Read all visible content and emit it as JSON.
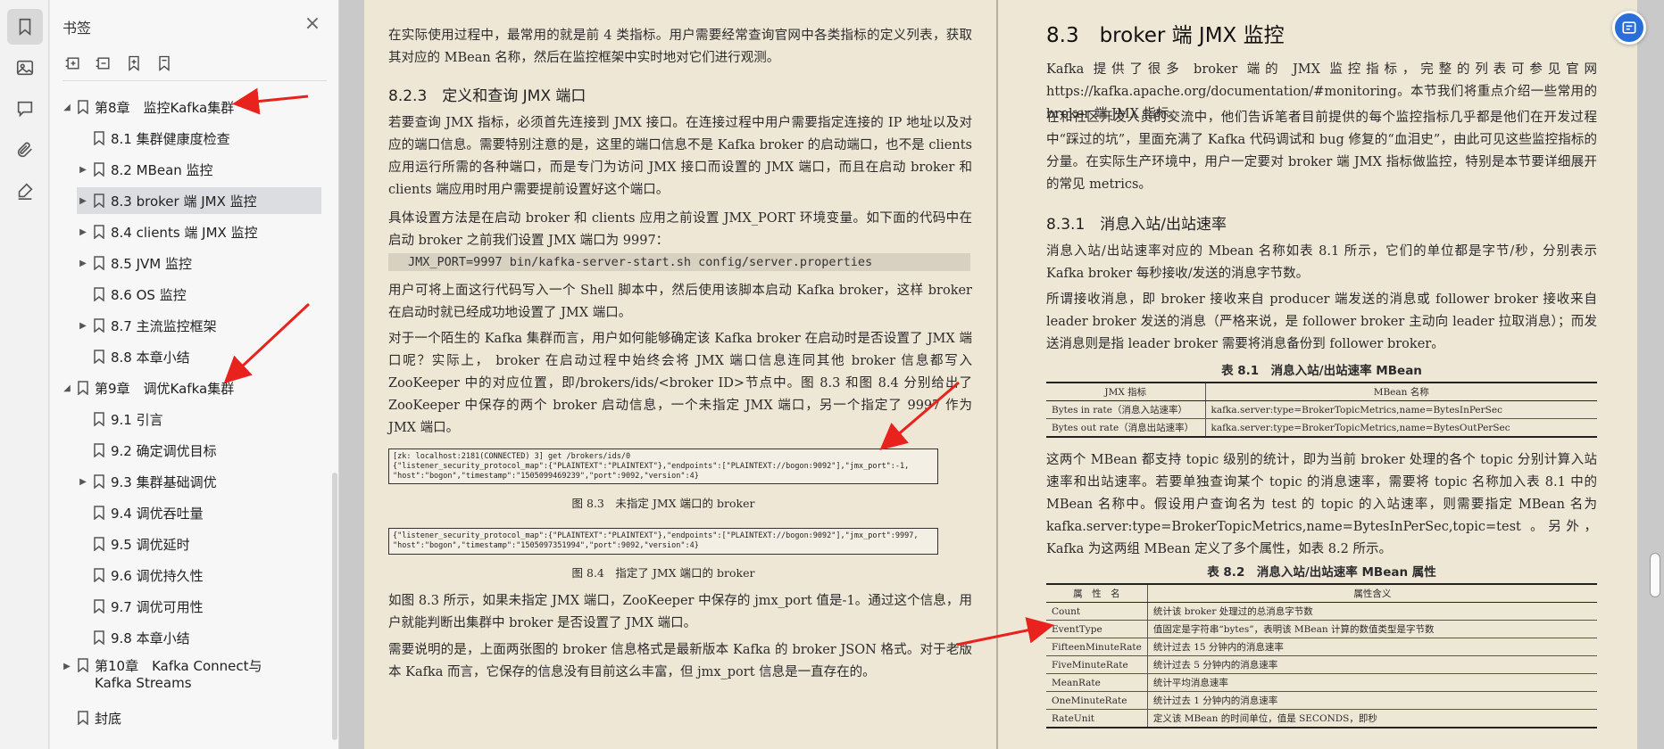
{
  "sidebar_panel": {
    "title": "书签",
    "items": [
      {
        "label": "第8章　监控Kafka集群",
        "level": 0,
        "expanded": true
      },
      {
        "label": "8.1 集群健康度检查",
        "level": 1
      },
      {
        "label": "8.2 MBean 监控",
        "level": 1,
        "collapsed": true
      },
      {
        "label": "8.3 broker 端 JMX 监控",
        "level": 1,
        "collapsed": true,
        "selected": true
      },
      {
        "label": "8.4 clients 端 JMX 监控",
        "level": 1,
        "collapsed": true
      },
      {
        "label": "8.5 JVM 监控",
        "level": 1,
        "collapsed": true
      },
      {
        "label": "8.6 OS 监控",
        "level": 1
      },
      {
        "label": "8.7 主流监控框架",
        "level": 1,
        "collapsed": true
      },
      {
        "label": "8.8 本章小结",
        "level": 1
      },
      {
        "label": "第9章　调优Kafka集群",
        "level": 0,
        "expanded": true
      },
      {
        "label": "9.1 引言",
        "level": 1
      },
      {
        "label": "9.2 确定调优目标",
        "level": 1
      },
      {
        "label": "9.3 集群基础调优",
        "level": 1,
        "collapsed": true
      },
      {
        "label": "9.4 调优吞吐量",
        "level": 1
      },
      {
        "label": "9.5 调优延时",
        "level": 1
      },
      {
        "label": "9.6 调优持久性",
        "level": 1
      },
      {
        "label": "9.7 调优可用性",
        "level": 1
      },
      {
        "label": "9.8 本章小结",
        "level": 1
      },
      {
        "label": "第10章　Kafka Connect与Kafka Streams",
        "level": 0,
        "collapsed": true
      },
      {
        "label": "封底",
        "level": 0
      }
    ]
  },
  "left_page": {
    "p1": "在实际使用过程中，最常用的就是前 4 类指标。用户需要经常查询官网中各类指标的定义列表，获取其对应的 MBean 名称，然后在监控框架中实时地对它们进行观测。",
    "h_823": "8.2.3　定义和查询 JMX 端口",
    "p2": "若要查询 JMX 指标，必须首先连接到 JMX 接口。在连接过程中用户需要指定连接的 IP 地址以及对应的端口信息。需要特别注意的是，这里的端口信息不是 Kafka broker 的启动端口，也不是 clients 应用运行所需的各种端口，而是专门为访问 JMX 接口而设置的 JMX 端口，而且在启动 broker 和 clients 端应用时用户需要提前设置好这个端口。",
    "p3": "具体设置方法是在启动 broker 和 clients 应用之前设置 JMX_PORT 环境变量。如下面的代码中在启动 broker 之前我们设置 JMX 端口为 9997：",
    "code1": "JMX_PORT=9997 bin/kafka-server-start.sh config/server.properties",
    "p4": "用户可将上面这行代码写入一个 Shell 脚本中，然后使用该脚本启动 Kafka broker，这样 broker 在启动时就已经成功地设置了 JMX 端口。",
    "p5": "对于一个陌生的 Kafka 集群而言，用户如何能够确定该 Kafka broker 在启动时是否设置了 JMX 端口呢？实际上， broker 在启动过程中始终会将 JMX 端口信息连同其他 broker 信息都写入 ZooKeeper 中的对应位置，即/brokers/ids/<broker ID>节点中。图 8.3 和图 8.4 分别给出了 ZooKeeper 中保存的两个 broker 启动信息，一个未指定 JMX 端口，另一个指定了 9997 作为 JMX 端口。",
    "fig3_code": "[zk: localhost:2181(CONNECTED) 3] get /brokers/ids/0\n{\"listener_security_protocol_map\":{\"PLAINTEXT\":\"PLAINTEXT\"},\"endpoints\":[\"PLAINTEXT://bogon:9092\"],\"jmx_port\":-1,\n\"host\":\"bogon\",\"timestamp\":\"1505099469239\",\"port\":9092,\"version\":4}",
    "fig3_cap": "图 8.3　未指定 JMX 端口的 broker",
    "fig4_code": "{\"listener_security_protocol_map\":{\"PLAINTEXT\":\"PLAINTEXT\"},\"endpoints\":[\"PLAINTEXT://bogon:9092\"],\"jmx_port\":9997,\n\"host\":\"bogon\",\"timestamp\":\"1505097351994\",\"port\":9092,\"version\":4}",
    "fig4_cap": "图 8.4　指定了 JMX 端口的 broker",
    "p6": "如图 8.3 所示，如果未指定 JMX 端口，ZooKeeper 中保存的 jmx_port 值是-1。通过这个信息，用户就能判断出集群中 broker 是否设置了 JMX 端口。",
    "p7": "需要说明的是，上面两张图的 broker 信息格式是最新版本 Kafka 的 broker JSON 格式。对于老版本 Kafka 而言，它保存的信息没有目前这么丰富，但 jmx_port 信息是一直存在的。"
  },
  "right_page": {
    "h_83": "8.3　broker 端 JMX 监控",
    "p1": "Kafka 提供了很多 broker 端的 JMX 监控指标，完整的列表可参见官网 https://kafka.apache.org/documentation/#monitoring。本节我们将重点介绍一些常用的 broker 端 JMX 指标。",
    "p2": "在和社区开发人员的交流中，他们告诉笔者目前提供的每个监控指标几乎都是他们在开发过程中“踩过的坑”，里面充满了 Kafka 代码调试和 bug 修复的“血泪史”，由此可见这些监控指标的分量。在实际生产环境中，用户一定要对 broker 端 JMX 指标做监控，特别是本节要详细展开的常见 metrics。",
    "h_831": "8.3.1　消息入站/出站速率",
    "p3": "消息入站/出站速率对应的 Mbean 名称如表 8.1 所示，它们的单位都是字节/秒，分别表示 Kafka broker 每秒接收/发送的消息字节数。",
    "p4": "所谓接收消息，即 broker 接收来自 producer 端发送的消息或 follower broker 接收来自 leader broker 发送的消息（严格来说，是 follower broker 主动向 leader 拉取消息）；而发送消息则是指 leader broker 需要将消息备份到 follower broker。",
    "t1_cap": "表 8.1　消息入站/出站速率 MBean",
    "t1_headers": [
      "JMX 指标",
      "MBean 名称"
    ],
    "t1_rows": [
      [
        "Bytes in rate（消息入站速率）",
        "kafka.server:type=BrokerTopicMetrics,name=BytesInPerSec"
      ],
      [
        "Bytes out rate（消息出站速率）",
        "kafka.server:type=BrokerTopicMetrics,name=BytesOutPerSec"
      ]
    ],
    "p5": "这两个 MBean 都支持 topic 级别的统计，即为当前 broker 处理的各个 topic 分别计算入站速率和出站速率。若要单独查询某个 topic 的消息速率，需要将 topic 名称加入表 8.1 中的 MBean 名称中。假设用户查询名为 test 的 topic 的入站速率，则需要指定 MBean 名为 kafka.server:type=BrokerTopicMetrics,name=BytesInPerSec,topic=test 。另外，Kafka 为这两组 MBean 定义了多个属性，如表 8.2 所示。",
    "t2_cap": "表 8.2　消息入站/出站速率 MBean 属性",
    "t2_headers": [
      "属　性　名",
      "属性含义"
    ],
    "t2_rows": [
      [
        "Count",
        "统计该 broker 处理过的总消息字节数"
      ],
      [
        "EventType",
        "值固定是字符串“bytes”，表明该 MBean 计算的数值类型是字节数"
      ],
      [
        "FifteenMinuteRate",
        "统计过去 15 分钟内的消息速率"
      ],
      [
        "FiveMinuteRate",
        "统计过去 5 分钟内的消息速率"
      ],
      [
        "MeanRate",
        "统计平均消息速率"
      ],
      [
        "OneMinuteRate",
        "统计过去 1 分钟内的消息速率"
      ],
      [
        "RateUnit",
        "定义该 MBean 的时间单位，值是 SECONDS，即秒"
      ]
    ]
  },
  "colors": {
    "annotation_arrow": "#e8221c",
    "page_bg": "#efe7d6",
    "float_button": "#2a6fd8"
  }
}
